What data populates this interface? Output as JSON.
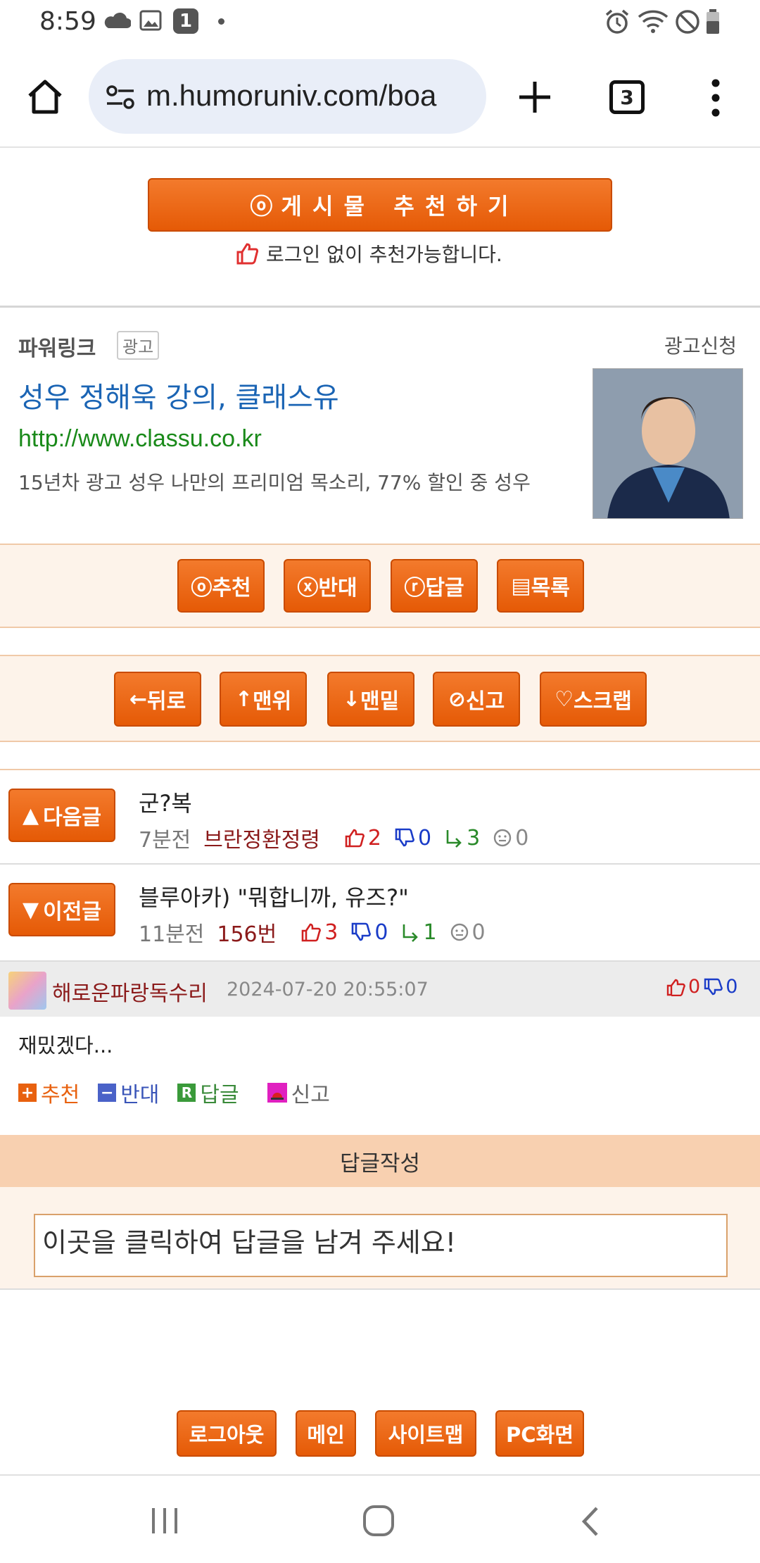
{
  "status": {
    "time": "8:59",
    "notif_count": "1"
  },
  "browser": {
    "url": "m.humoruniv.com/boa",
    "tab_count": "3"
  },
  "recommend": {
    "button_label": "게 시 물   추 천 하 기",
    "note": "로그인 없이 추천가능합니다."
  },
  "ad": {
    "label": "파워링크",
    "badge": "광고",
    "apply": "광고신청",
    "title": "성우 정해욱 강의, 클래스유",
    "url": "http://www.classu.co.kr",
    "desc": "15년차 광고 성우 나만의 프리미엄 목소리, 77% 할인 중 성우"
  },
  "actions": [
    {
      "icon": "ⓞ",
      "label": "추천"
    },
    {
      "icon": "ⓧ",
      "label": "반대"
    },
    {
      "icon": "ⓡ",
      "label": "답글"
    },
    {
      "icon": "▤",
      "label": "목록"
    }
  ],
  "nav": [
    {
      "icon": "←",
      "label": "뒤로"
    },
    {
      "icon": "↑",
      "label": "맨위"
    },
    {
      "icon": "↓",
      "label": "맨밑"
    },
    {
      "icon": "⊘",
      "label": "신고"
    },
    {
      "icon": "♡",
      "label": "스크랩"
    }
  ],
  "next_post": {
    "button": "다음글",
    "title": "군?복",
    "time": "7분전",
    "author": "브란정환정령",
    "up": "2",
    "down": "0",
    "reply": "3",
    "view": "0"
  },
  "prev_post": {
    "button": "이전글",
    "title": "블루아카) \"뭐합니까, 유즈?\"",
    "time": "11분전",
    "author": "156번",
    "up": "3",
    "down": "0",
    "reply": "1",
    "view": "0"
  },
  "comment": {
    "author": "해로운파랑독수리",
    "date": "2024-07-20 20:55:07",
    "up": "0",
    "down": "0",
    "text": "재밌겠다...",
    "actions": {
      "recommend": "추천",
      "oppose": "반대",
      "reply": "답글",
      "report": "신고"
    }
  },
  "reply": {
    "header": "답글작성",
    "placeholder": "이곳을 클릭하여 답글을 남겨 주세요!"
  },
  "footer": {
    "logout": "로그아웃",
    "main": "메인",
    "sitemap": "사이트맵",
    "pc": "PC화면"
  },
  "colors": {
    "accent": "#e8610f",
    "peach": "#fdf3ea",
    "link_blue": "#1a64b4",
    "url_green": "#1a8a1a"
  }
}
